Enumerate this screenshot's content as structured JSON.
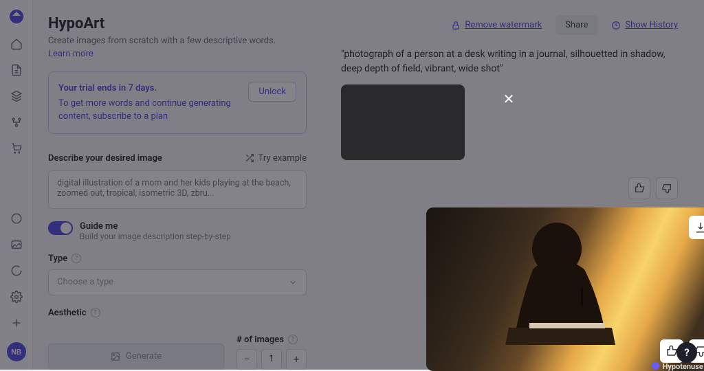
{
  "app": {
    "title": "HypoArt",
    "subtitle": "Create images from scratch with a few descriptive words.",
    "learn_more": "Learn more"
  },
  "trial": {
    "headline": "Your trial ends in 7 days.",
    "body": "To get more words and continue generating content, subscribe to a plan",
    "unlock": "Unlock"
  },
  "form": {
    "describe_label": "Describe your desired image",
    "try_example": "Try example",
    "placeholder": "digital illustration of a mom and her kids playing at the beach, zoomed out, tropical, isometric 3D, zbru...",
    "guide_title": "Guide me",
    "guide_sub": "Build your image description step-by-step",
    "type_label": "Type",
    "type_placeholder": "Choose a type",
    "aesthetic_label": "Aesthetic",
    "generate": "Generate",
    "num_label": "# of images",
    "num_value": "1"
  },
  "topbar": {
    "remove_watermark": "Remove watermark",
    "share": "Share",
    "show_history": "Show History"
  },
  "result": {
    "prompt": "\"photograph of a person at a desk writing in a journal, silhouetted in shadow, deep depth of field, vibrant, wide shot\""
  },
  "modal": {
    "watermark": "Hypotenuse AI"
  },
  "user": {
    "initials": "NB"
  }
}
